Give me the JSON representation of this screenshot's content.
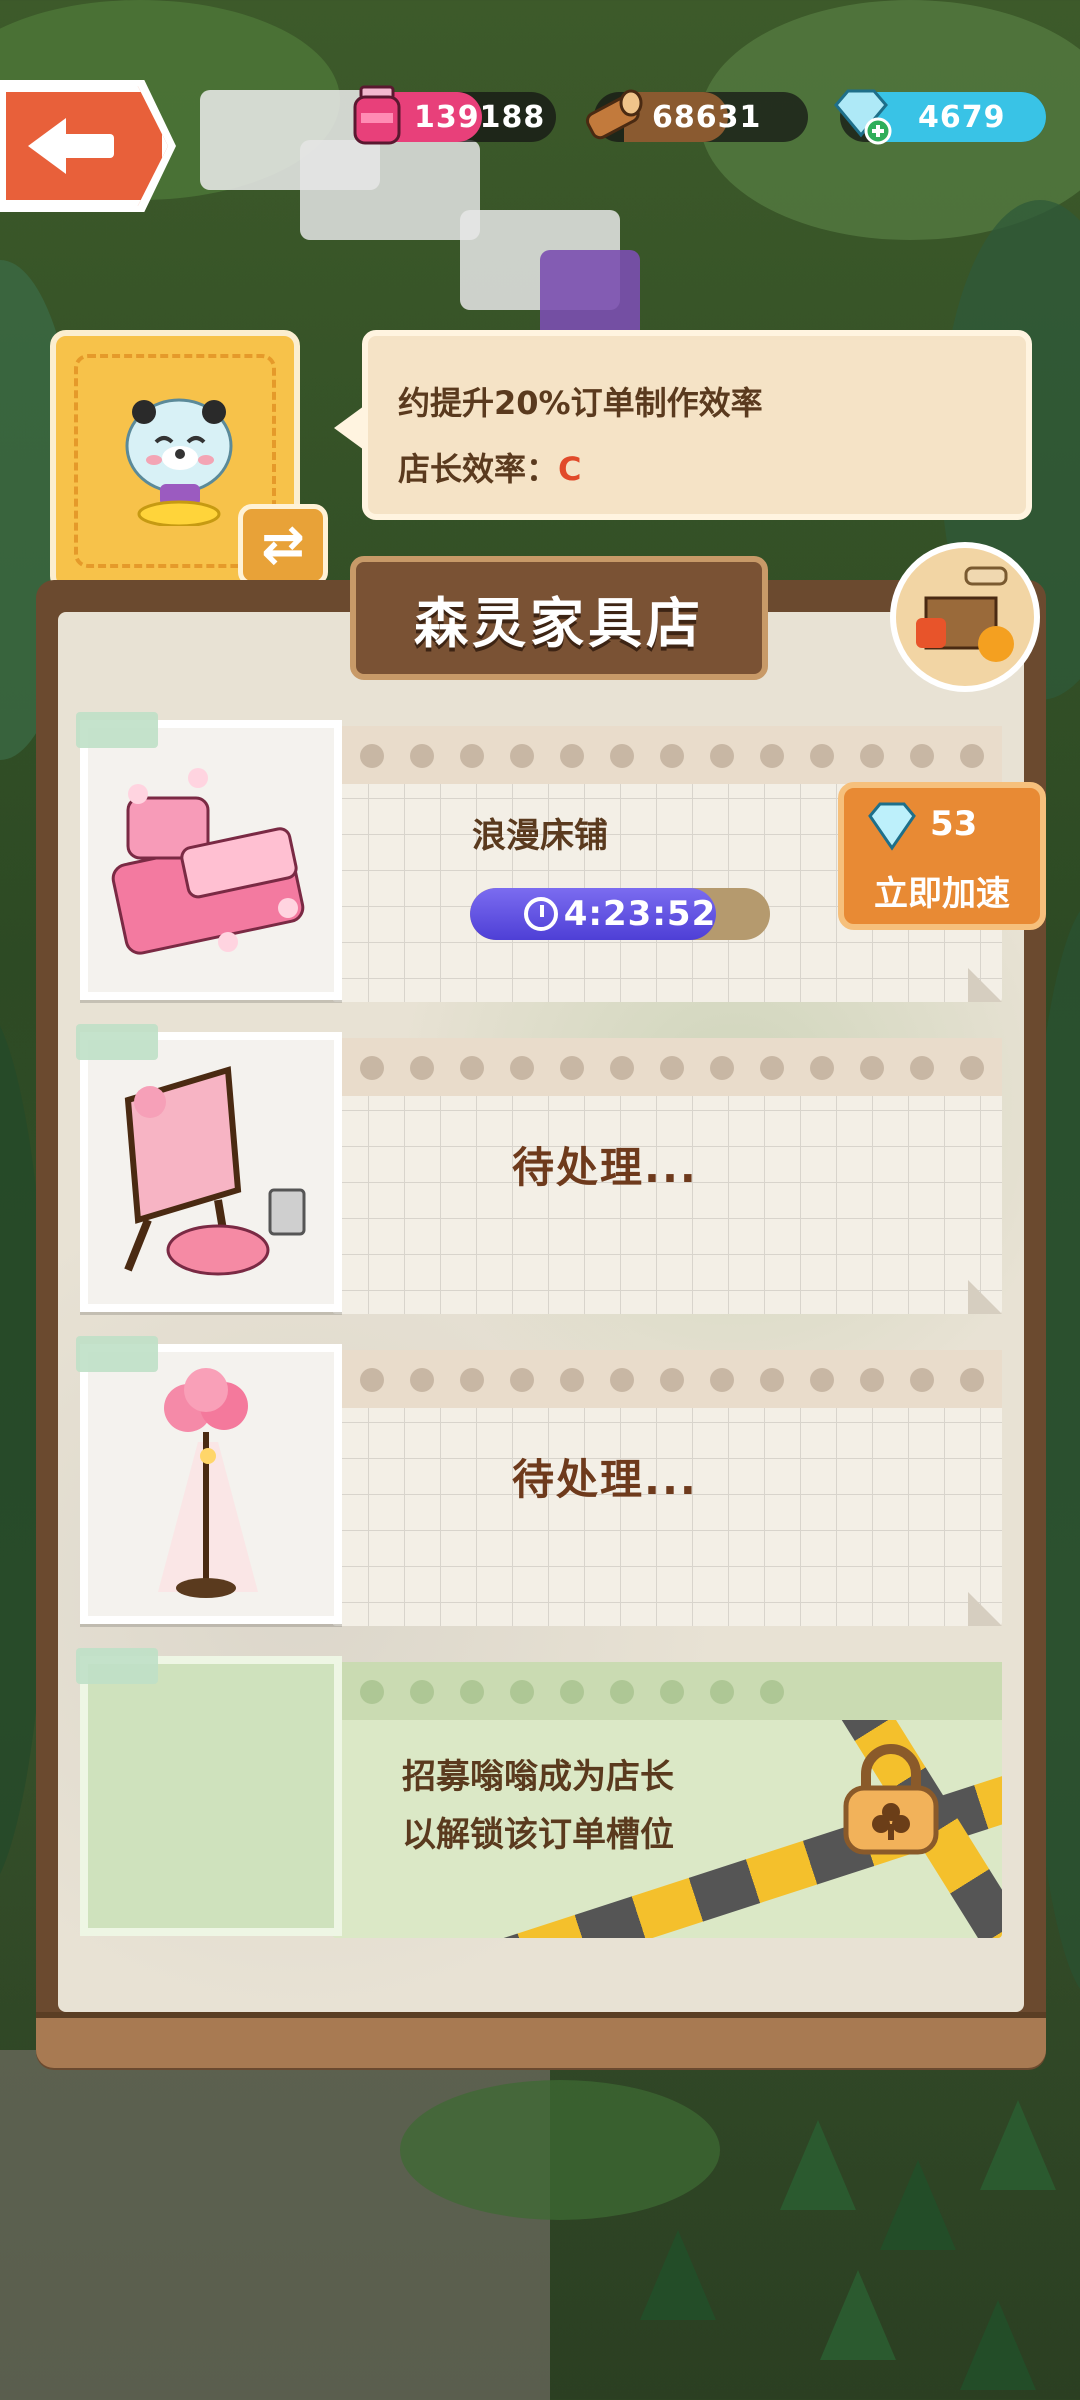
{
  "resources": {
    "ink": {
      "value": "139188",
      "icon": "ink-jar-icon",
      "color": "#e8407a"
    },
    "wood": {
      "value": "68631",
      "icon": "wood-log-icon",
      "color": "#8a5a30"
    },
    "gems": {
      "value": "4679",
      "icon": "diamond-plus-icon",
      "color": "#39c3e6"
    }
  },
  "manager": {
    "line1": "约提升20%订单制作效率",
    "line2_prefix": "店长效率：",
    "grade": "C"
  },
  "shop": {
    "title": "森灵家具店"
  },
  "slots": [
    {
      "state": "active",
      "item_name": "浪漫床铺",
      "timer": "4:23:52",
      "speed_cost": "53",
      "speed_label": "立即加速",
      "progress": 0.82
    },
    {
      "state": "pending",
      "label": "待处理..."
    },
    {
      "state": "pending",
      "label": "待处理..."
    },
    {
      "state": "locked",
      "line1": "招募嗡嗡成为店长",
      "line2": "以解锁该订单槽位"
    }
  ]
}
